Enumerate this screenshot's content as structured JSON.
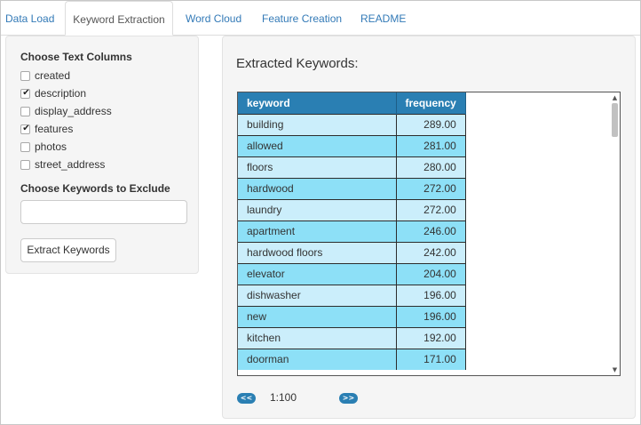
{
  "tabs": [
    {
      "label": "Data Load"
    },
    {
      "label": "Keyword Extraction"
    },
    {
      "label": "Word Cloud"
    },
    {
      "label": "Feature Creation"
    },
    {
      "label": "README"
    }
  ],
  "sidebar": {
    "text_columns_title": "Choose Text Columns",
    "columns": [
      {
        "label": "created",
        "checked": false
      },
      {
        "label": "description",
        "checked": true
      },
      {
        "label": "display_address",
        "checked": false
      },
      {
        "label": "features",
        "checked": true
      },
      {
        "label": "photos",
        "checked": false
      },
      {
        "label": "street_address",
        "checked": false
      }
    ],
    "exclude_title": "Choose Keywords to Exclude",
    "exclude_value": "",
    "extract_button": "Extract Keywords"
  },
  "main": {
    "title": "Extracted Keywords:",
    "table": {
      "headers": [
        "keyword",
        "frequency"
      ],
      "rows": [
        [
          "building",
          "289.00"
        ],
        [
          "allowed",
          "281.00"
        ],
        [
          "floors",
          "280.00"
        ],
        [
          "hardwood",
          "272.00"
        ],
        [
          "laundry",
          "272.00"
        ],
        [
          "apartment",
          "246.00"
        ],
        [
          "hardwood floors",
          "242.00"
        ],
        [
          "elevator",
          "204.00"
        ],
        [
          "dishwasher",
          "196.00"
        ],
        [
          "new",
          "196.00"
        ],
        [
          "kitchen",
          "192.00"
        ],
        [
          "doorman",
          "171.00"
        ]
      ]
    },
    "pager": {
      "prev_label": "<<",
      "range": "1:100",
      "next_label": ">>"
    }
  },
  "colors": {
    "accent": "#2a7fb3",
    "row_light": "#cbeefb",
    "row_dark": "#8de0f7",
    "link": "#337ab7"
  }
}
